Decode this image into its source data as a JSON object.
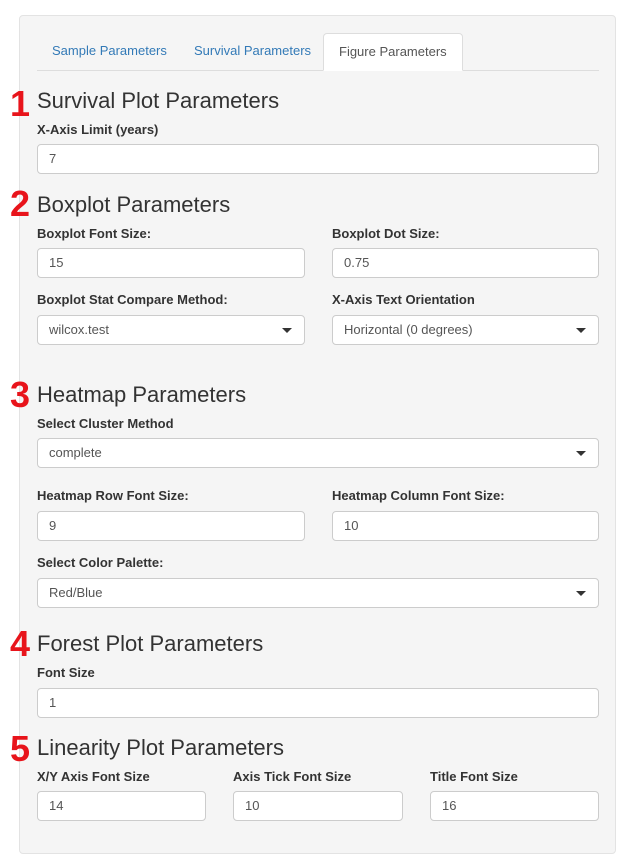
{
  "tabs": [
    {
      "label": "Sample Parameters"
    },
    {
      "label": "Survival Parameters"
    },
    {
      "label": "Figure Parameters",
      "active": true
    }
  ],
  "sections": {
    "survival": {
      "number": "1",
      "title": "Survival Plot Parameters",
      "xaxis_limit": {
        "label": "X-Axis Limit (years)",
        "value": "7"
      }
    },
    "boxplot": {
      "number": "2",
      "title": "Boxplot Parameters",
      "font_size": {
        "label": "Boxplot Font Size:",
        "value": "15"
      },
      "dot_size": {
        "label": "Boxplot Dot Size:",
        "value": "0.75"
      },
      "stat_method": {
        "label": "Boxplot Stat Compare Method:",
        "value": "wilcox.test"
      },
      "x_text_orientation": {
        "label": "X-Axis Text Orientation",
        "value": "Horizontal (0 degrees)"
      }
    },
    "heatmap": {
      "number": "3",
      "title": "Heatmap Parameters",
      "cluster_method": {
        "label": "Select Cluster Method",
        "value": "complete"
      },
      "row_font_size": {
        "label": "Heatmap Row Font Size:",
        "value": "9"
      },
      "col_font_size": {
        "label": "Heatmap Column Font Size:",
        "value": "10"
      },
      "color_palette": {
        "label": "Select Color Palette:",
        "value": "Red/Blue"
      }
    },
    "forest": {
      "number": "4",
      "title": "Forest Plot Parameters",
      "font_size": {
        "label": "Font Size",
        "value": "1"
      }
    },
    "linearity": {
      "number": "5",
      "title": "Linearity Plot Parameters",
      "xy_axis_font_size": {
        "label": "X/Y Axis Font Size",
        "value": "14"
      },
      "axis_tick_font_size": {
        "label": "Axis Tick Font Size",
        "value": "10"
      },
      "title_font_size": {
        "label": "Title Font Size",
        "value": "16"
      }
    }
  },
  "colors": {
    "annotation_number": "#e8141b",
    "tab_link": "#337ab7",
    "panel_bg": "#f5f5f5"
  },
  "icons": {
    "dropdown": "caret-down-icon"
  }
}
